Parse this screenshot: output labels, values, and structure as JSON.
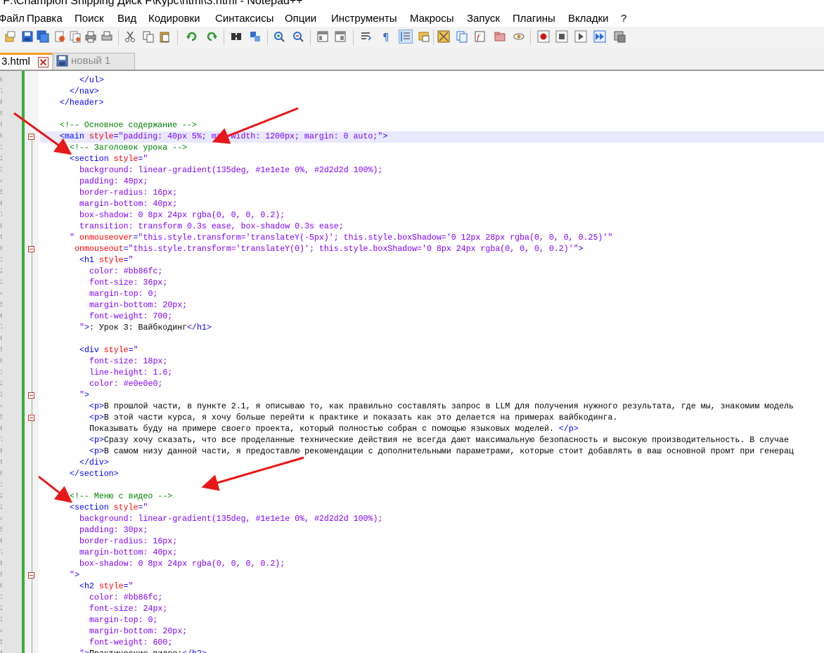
{
  "window": {
    "title": "*F:\\Champion Shipping Диск F\\Курс\\html\\3.html - Notepad++"
  },
  "menu": [
    "Файл",
    "Правка",
    "Поиск",
    "Вид",
    "Кодировки",
    "Синтаксисы",
    "Опции",
    "Инструменты",
    "Макросы",
    "Запуск",
    "Плагины",
    "Вкладки",
    "?"
  ],
  "toolbar": {
    "icons": [
      "new-file-icon",
      "open-file-icon",
      "save-icon",
      "save-all-icon",
      "close-icon",
      "close-all-icon",
      "print-icon",
      "cut-icon",
      "copy-icon",
      "paste-icon",
      "undo-icon",
      "redo-icon",
      "find-icon",
      "replace-icon",
      "zoom-in-icon",
      "zoom-out-icon",
      "sync-vertical-icon",
      "sync-horizontal-icon",
      "word-wrap-icon",
      "show-all-chars-icon",
      "indent-guide-icon",
      "user-lang-icon",
      "doc-map-icon",
      "doc-list-icon",
      "function-list-icon",
      "folder-workspace-icon",
      "monitoring-icon",
      "record-macro-icon",
      "stop-macro-icon",
      "play-macro-icon",
      "run-macro-multiple-icon",
      "save-macro-icon"
    ]
  },
  "tabs": [
    {
      "label": "3.html",
      "active": true
    },
    {
      "label": "новый 1",
      "active": false
    }
  ],
  "editor": {
    "lines": [
      {
        "num": "6",
        "i": 8,
        "t": [
          [
            "tg",
            "</ul>"
          ]
        ]
      },
      {
        "num": "7",
        "i": 6,
        "t": [
          [
            "tg",
            "</nav>"
          ]
        ]
      },
      {
        "num": "8",
        "i": 4,
        "t": [
          [
            "tg",
            "</header>"
          ]
        ]
      },
      {
        "num": "9",
        "i": 0,
        "t": []
      },
      {
        "num": "9",
        "i": 4,
        "t": [
          [
            "cm",
            "<!-- Основное содержание -->"
          ]
        ]
      },
      {
        "num": "0",
        "i": 4,
        "hl": true,
        "fold": true,
        "t": [
          [
            "tg",
            "<main "
          ],
          [
            "at",
            "style"
          ],
          [
            "tg",
            "="
          ],
          [
            "vl",
            "\"padding: 40px 5%; max-width: 1200px; margin: 0 auto;\""
          ],
          [
            "tg",
            ">"
          ]
        ]
      },
      {
        "num": "1",
        "i": 6,
        "t": [
          [
            "cm",
            "<!-- Заголовок урока -->"
          ]
        ]
      },
      {
        "num": "2",
        "i": 6,
        "t": [
          [
            "tg",
            "<section "
          ],
          [
            "at",
            "style"
          ],
          [
            "tg",
            "="
          ],
          [
            "vl",
            "\""
          ]
        ]
      },
      {
        "num": "3",
        "i": 8,
        "t": [
          [
            "vl",
            "background: linear-gradient(135deg, #1e1e1e 0%, #2d2d2d 100%);"
          ]
        ]
      },
      {
        "num": "4",
        "i": 8,
        "t": [
          [
            "vl",
            "padding: 40px;"
          ]
        ]
      },
      {
        "num": "5",
        "i": 8,
        "t": [
          [
            "vl",
            "border-radius: 16px;"
          ]
        ]
      },
      {
        "num": "6",
        "i": 8,
        "t": [
          [
            "vl",
            "margin-bottom: 40px;"
          ]
        ]
      },
      {
        "num": "7",
        "i": 8,
        "t": [
          [
            "vl",
            "box-shadow: 0 8px 24px rgba(0, 0, 0, 0.2);"
          ]
        ]
      },
      {
        "num": "8",
        "i": 8,
        "t": [
          [
            "vl",
            "transition: transform 0.3s ease, box-shadow 0.3s ease;"
          ]
        ]
      },
      {
        "num": "9",
        "i": 6,
        "t": [
          [
            "vl",
            "\" "
          ],
          [
            "at",
            "onmouseover"
          ],
          [
            "tg",
            "="
          ],
          [
            "vl",
            "\"this.style.transform='translateY(-5px)'; this.style.boxShadow='0 12px 28px rgba(0, 0, 0, 0.25)'\""
          ]
        ]
      },
      {
        "num": "0",
        "i": 7,
        "fold": true,
        "t": [
          [
            "at",
            "onmouseout"
          ],
          [
            "tg",
            "="
          ],
          [
            "vl",
            "\"this.style.transform='translateY(0)'; this.style.boxShadow='0 8px 24px rgba(0, 0, 0, 0.2)'\""
          ],
          [
            "tg",
            ">"
          ]
        ]
      },
      {
        "num": "1",
        "i": 8,
        "t": [
          [
            "tg",
            "<h1 "
          ],
          [
            "at",
            "style"
          ],
          [
            "tg",
            "="
          ],
          [
            "vl",
            "\""
          ]
        ]
      },
      {
        "num": "2",
        "i": 10,
        "t": [
          [
            "vl",
            "color: #bb86fc;"
          ]
        ]
      },
      {
        "num": "3",
        "i": 10,
        "t": [
          [
            "vl",
            "font-size: 36px;"
          ]
        ]
      },
      {
        "num": "4",
        "i": 10,
        "t": [
          [
            "vl",
            "margin-top: 0;"
          ]
        ]
      },
      {
        "num": "5",
        "i": 10,
        "t": [
          [
            "vl",
            "margin-bottom: 20px;"
          ]
        ]
      },
      {
        "num": "6",
        "i": 10,
        "t": [
          [
            "vl",
            "font-weight: 700;"
          ]
        ]
      },
      {
        "num": "7",
        "i": 8,
        "t": [
          [
            "vl",
            "\""
          ],
          [
            "tg",
            ">"
          ],
          [
            "",
            ": Урок 3: Вайбкодинг"
          ],
          [
            "tg",
            "</h1>"
          ]
        ]
      },
      {
        "num": "8",
        "i": 0,
        "t": []
      },
      {
        "num": "9",
        "i": 8,
        "t": [
          [
            "tg",
            "<div "
          ],
          [
            "at",
            "style"
          ],
          [
            "tg",
            "="
          ],
          [
            "vl",
            "\""
          ]
        ]
      },
      {
        "num": "0",
        "i": 10,
        "t": [
          [
            "vl",
            "font-size: 18px;"
          ]
        ]
      },
      {
        "num": "1",
        "i": 10,
        "t": [
          [
            "vl",
            "line-height: 1.6;"
          ]
        ]
      },
      {
        "num": "2",
        "i": 10,
        "t": [
          [
            "vl",
            "color: #e0e0e0;"
          ]
        ]
      },
      {
        "num": "3",
        "i": 8,
        "fold": true,
        "t": [
          [
            "vl",
            "\""
          ],
          [
            "tg",
            ">"
          ]
        ]
      },
      {
        "num": "4",
        "i": 10,
        "t": [
          [
            "tg",
            "<p>"
          ],
          [
            "",
            "В прошлой части, в пункте 2.1, я описываю то, как правильно составлять запрос в LLM для получения нужного результата, где мы, знакомим модель"
          ]
        ]
      },
      {
        "num": "5",
        "i": 10,
        "fold": true,
        "t": [
          [
            "tg",
            "<p>"
          ],
          [
            "",
            "В этой части курса, я хочу больше перейти к практике и показать как это делается на примерах вайбкодинга."
          ]
        ]
      },
      {
        "num": "6",
        "i": 10,
        "t": [
          [
            "",
            "Показывать буду на примере своего проекта, который полностью собран с помощью языковых моделей. "
          ],
          [
            "tg",
            "</p>"
          ]
        ]
      },
      {
        "num": "7",
        "i": 10,
        "t": [
          [
            "tg",
            "<p>"
          ],
          [
            "",
            "Сразу хочу сказать, что все проделанные технические действия не всегда дают максимальную безопасность и высокую производительность. В случае"
          ]
        ]
      },
      {
        "num": "8",
        "i": 10,
        "t": [
          [
            "tg",
            "<p>"
          ],
          [
            "",
            "В самом низу данной части, я предоставлю рекомендации с дополнительными параметрами, которые стоит добавлять в ваш основной промт при генерац"
          ]
        ]
      },
      {
        "num": "9",
        "i": 8,
        "t": [
          [
            "tg",
            "</div>"
          ]
        ]
      },
      {
        "num": "0",
        "i": 6,
        "t": [
          [
            "tg",
            "</section>"
          ]
        ]
      },
      {
        "num": "1",
        "i": 0,
        "t": []
      },
      {
        "num": "2",
        "i": 6,
        "t": [
          [
            "cm",
            "<!-- Меню с видео -->"
          ]
        ]
      },
      {
        "num": "2",
        "i": 6,
        "t": [
          [
            "tg",
            "<section "
          ],
          [
            "at",
            "style"
          ],
          [
            "tg",
            "="
          ],
          [
            "vl",
            "\""
          ]
        ]
      },
      {
        "num": "4",
        "i": 8,
        "t": [
          [
            "vl",
            "background: linear-gradient(135deg, #1e1e1e 0%, #2d2d2d 100%);"
          ]
        ]
      },
      {
        "num": "5",
        "i": 8,
        "t": [
          [
            "vl",
            "padding: 30px;"
          ]
        ]
      },
      {
        "num": "6",
        "i": 8,
        "t": [
          [
            "vl",
            "border-radius: 16px;"
          ]
        ]
      },
      {
        "num": "7",
        "i": 8,
        "t": [
          [
            "vl",
            "margin-bottom: 40px;"
          ]
        ]
      },
      {
        "num": "8",
        "i": 8,
        "t": [
          [
            "vl",
            "box-shadow: 0 8px 24px rgba(0, 0, 0, 0.2);"
          ]
        ]
      },
      {
        "num": "9",
        "i": 6,
        "fold": true,
        "t": [
          [
            "vl",
            "\""
          ],
          [
            "tg",
            ">"
          ]
        ]
      },
      {
        "num": "0",
        "i": 8,
        "t": [
          [
            "tg",
            "<h2 "
          ],
          [
            "at",
            "style"
          ],
          [
            "tg",
            "="
          ],
          [
            "vl",
            "\""
          ]
        ]
      },
      {
        "num": "1",
        "i": 10,
        "t": [
          [
            "vl",
            "color: #bb86fc;"
          ]
        ]
      },
      {
        "num": "2",
        "i": 10,
        "t": [
          [
            "vl",
            "font-size: 24px;"
          ]
        ]
      },
      {
        "num": "3",
        "i": 10,
        "t": [
          [
            "vl",
            "margin-top: 0;"
          ]
        ]
      },
      {
        "num": "4",
        "i": 10,
        "t": [
          [
            "vl",
            "margin-bottom: 20px;"
          ]
        ]
      },
      {
        "num": "5",
        "i": 10,
        "t": [
          [
            "vl",
            "font-weight: 600;"
          ]
        ]
      },
      {
        "num": "6",
        "i": 8,
        "t": [
          [
            "vl",
            "\""
          ],
          [
            "tg",
            ">"
          ],
          [
            "",
            "Практические видео:"
          ],
          [
            "tg",
            "</h2>"
          ]
        ]
      }
    ]
  },
  "colors": {
    "tag": "#0000ff",
    "attr": "#ff0000",
    "value": "#8000ff",
    "comment": "#008000",
    "arrow": "#e81818",
    "tab_accent": "#f39c28"
  }
}
